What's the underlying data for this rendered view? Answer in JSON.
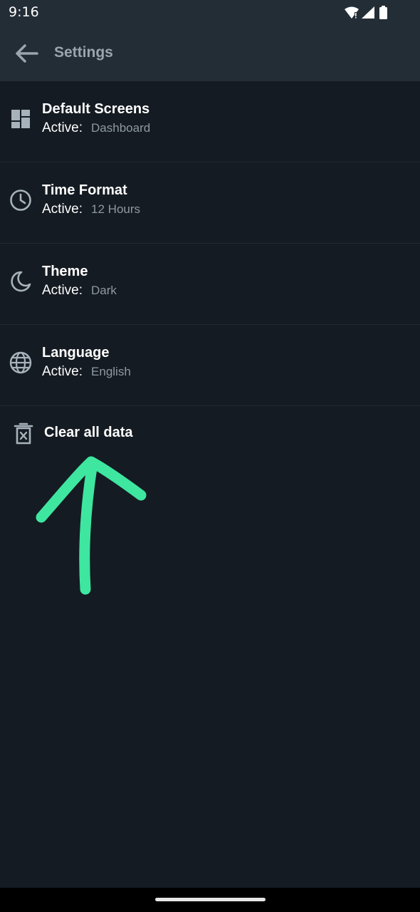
{
  "status_bar": {
    "time": "9:16",
    "icons": [
      "wifi-icon",
      "signal-icon",
      "battery-icon"
    ]
  },
  "app_bar": {
    "back_icon": "back-arrow-icon",
    "title": "Settings"
  },
  "settings": [
    {
      "icon": "dashboard-icon",
      "title": "Default Screens",
      "active_label": "Active:",
      "value": "Dashboard"
    },
    {
      "icon": "clock-icon",
      "title": "Time Format",
      "active_label": "Active:",
      "value": "12 Hours"
    },
    {
      "icon": "moon-icon",
      "title": "Theme",
      "active_label": "Active:",
      "value": "Dark"
    },
    {
      "icon": "globe-icon",
      "title": "Language",
      "active_label": "Active:",
      "value": "English"
    }
  ],
  "clear_data": {
    "icon": "trash-icon",
    "label": "Clear all data"
  },
  "annotation": {
    "type": "arrow",
    "color": "#3ee6a0"
  },
  "colors": {
    "background": "#151b22",
    "app_bar": "#232d36",
    "title_gray": "#9aa5ad",
    "value_gray": "#8e99a1",
    "icon_gray": "#a7b2ba"
  }
}
